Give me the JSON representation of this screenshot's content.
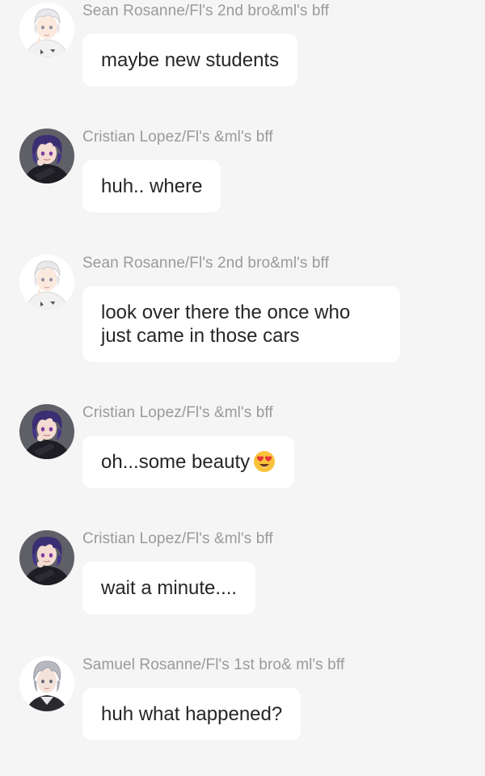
{
  "messages": [
    {
      "sender": "Sean Rosanne/Fl's 2nd bro&ml's bff",
      "avatar": "white-haired-boy-avatar",
      "lines": [
        "maybe new students"
      ]
    },
    {
      "sender": "Cristian Lopez/Fl's &ml's bff",
      "avatar": "purple-haired-boy-avatar",
      "lines": [
        "huh.. where"
      ]
    },
    {
      "sender": "Sean Rosanne/Fl's 2nd bro&ml's bff",
      "avatar": "white-haired-boy-avatar",
      "lines": [
        "look over there the once who",
        "just came in those cars"
      ]
    },
    {
      "sender": "Cristian Lopez/Fl's &ml's bff",
      "avatar": "purple-haired-boy-avatar",
      "lines": [
        "oh...some beauty"
      ],
      "emoji": "heart-eyes-emoji"
    },
    {
      "sender": "Cristian Lopez/Fl's &ml's bff",
      "avatar": "purple-haired-boy-avatar",
      "lines": [
        "wait a minute...."
      ]
    },
    {
      "sender": "Samuel Rosanne/Fl's 1st bro& ml's bff",
      "avatar": "silver-haired-man-avatar",
      "lines": [
        "huh what happened?"
      ]
    }
  ],
  "colors": {
    "background": "#f5f5f5",
    "bubble": "#ffffff",
    "sender_text": "#9a9a9a",
    "message_text": "#262626"
  }
}
